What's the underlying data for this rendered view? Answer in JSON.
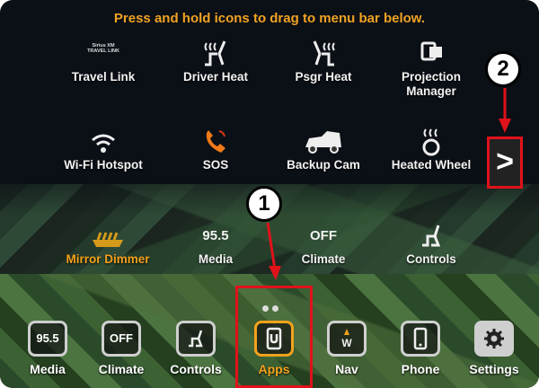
{
  "instruction": "Press and hold icons to drag to menu bar below.",
  "grid": {
    "row1": [
      {
        "label": "Travel Link",
        "icon": "travel-link-logo",
        "logo_text": "Sirius XM TRAVEL LINK"
      },
      {
        "label": "Driver Heat",
        "icon": "driver-heated-seat-icon"
      },
      {
        "label": "Psgr Heat",
        "icon": "passenger-heated-seat-icon"
      },
      {
        "label": "Projection Manager",
        "icon": "projection-icon"
      }
    ],
    "row2": [
      {
        "label": "Wi-Fi Hotspot",
        "icon": "wifi-icon"
      },
      {
        "label": "SOS",
        "icon": "phone-sos-icon"
      },
      {
        "label": "Backup Cam",
        "icon": "car-camera-icon"
      },
      {
        "label": "Heated Wheel",
        "icon": "heated-steering-wheel-icon"
      }
    ],
    "row3": [
      {
        "label": "Mirror Dimmer",
        "icon": "mirror-dimmer-icon"
      },
      {
        "label": "Media",
        "value": "95.5"
      },
      {
        "label": "Climate",
        "value": "OFF"
      },
      {
        "label": "Controls",
        "icon": "seat-controls-icon"
      }
    ]
  },
  "dock": [
    {
      "label": "Media",
      "value": "95.5"
    },
    {
      "label": "Climate",
      "value": "OFF"
    },
    {
      "label": "Controls",
      "icon": "seat-controls-icon"
    },
    {
      "label": "Apps",
      "icon": "apps-icon"
    },
    {
      "label": "Nav",
      "icon": "compass-icon"
    },
    {
      "label": "Phone",
      "icon": "phone-icon"
    },
    {
      "label": "Settings",
      "icon": "gear-icon"
    }
  ],
  "callouts": {
    "one": "1",
    "two": "2"
  },
  "next_glyph": ">",
  "colors": {
    "accent": "#f4a21d",
    "highlight": "#e0121a"
  }
}
